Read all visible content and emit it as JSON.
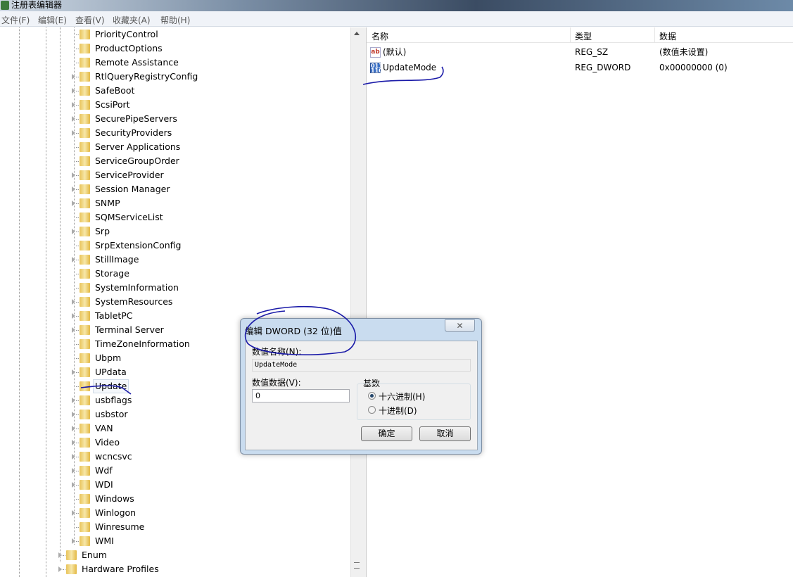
{
  "window": {
    "title": "注册表编辑器"
  },
  "menu": [
    "文件(F)",
    "编辑(E)",
    "查看(V)",
    "收藏夹(A)",
    "帮助(H)"
  ],
  "tree": {
    "items": [
      {
        "label": "PriorityControl",
        "expandable": false
      },
      {
        "label": "ProductOptions",
        "expandable": false
      },
      {
        "label": "Remote Assistance",
        "expandable": false
      },
      {
        "label": "RtlQueryRegistryConfig",
        "expandable": true
      },
      {
        "label": "SafeBoot",
        "expandable": true
      },
      {
        "label": "ScsiPort",
        "expandable": true
      },
      {
        "label": "SecurePipeServers",
        "expandable": true
      },
      {
        "label": "SecurityProviders",
        "expandable": true
      },
      {
        "label": "Server Applications",
        "expandable": false
      },
      {
        "label": "ServiceGroupOrder",
        "expandable": false
      },
      {
        "label": "ServiceProvider",
        "expandable": true
      },
      {
        "label": "Session Manager",
        "expandable": true
      },
      {
        "label": "SNMP",
        "expandable": true
      },
      {
        "label": "SQMServiceList",
        "expandable": false
      },
      {
        "label": "Srp",
        "expandable": true
      },
      {
        "label": "SrpExtensionConfig",
        "expandable": false
      },
      {
        "label": "StillImage",
        "expandable": true
      },
      {
        "label": "Storage",
        "expandable": false
      },
      {
        "label": "SystemInformation",
        "expandable": false
      },
      {
        "label": "SystemResources",
        "expandable": true
      },
      {
        "label": "TabletPC",
        "expandable": true
      },
      {
        "label": "Terminal Server",
        "expandable": true
      },
      {
        "label": "TimeZoneInformation",
        "expandable": false
      },
      {
        "label": "Ubpm",
        "expandable": false
      },
      {
        "label": "UPdata",
        "expandable": true
      },
      {
        "label": "Update",
        "expandable": false,
        "selected": true
      },
      {
        "label": "usbflags",
        "expandable": true
      },
      {
        "label": "usbstor",
        "expandable": true
      },
      {
        "label": "VAN",
        "expandable": true
      },
      {
        "label": "Video",
        "expandable": true
      },
      {
        "label": "wcncsvc",
        "expandable": true
      },
      {
        "label": "Wdf",
        "expandable": true
      },
      {
        "label": "WDI",
        "expandable": true
      },
      {
        "label": "Windows",
        "expandable": false
      },
      {
        "label": "Winlogon",
        "expandable": true
      },
      {
        "label": "Winresume",
        "expandable": false
      },
      {
        "label": "WMI",
        "expandable": true
      }
    ],
    "parent_items": [
      {
        "label": "Enum",
        "expandable": true
      },
      {
        "label": "Hardware Profiles",
        "expandable": true
      }
    ]
  },
  "list": {
    "columns": [
      "名称",
      "类型",
      "数据"
    ],
    "rows": [
      {
        "name": "(默认)",
        "type": "REG_SZ",
        "data": "(数值未设置)",
        "icon": "string-value-icon",
        "icon_text": "ab"
      },
      {
        "name": "UpdateMode",
        "type": "REG_DWORD",
        "data": "0x00000000 (0)",
        "icon": "binary-value-icon",
        "icon_text": "011 110"
      }
    ]
  },
  "dialog": {
    "title": "编辑 DWORD (32 位)值",
    "close": "✕",
    "name_label": "数值名称(N):",
    "name_value": "UpdateMode",
    "data_label": "数值数据(V):",
    "data_value": "0",
    "base_label": "基数",
    "hex_label": "十六进制(H)",
    "dec_label": "十进制(D)",
    "base_selected": "hex",
    "ok": "确定",
    "cancel": "取消"
  },
  "colors": {
    "annotation": "#1a1aa8",
    "dialog_frame": "#c9dcef"
  }
}
